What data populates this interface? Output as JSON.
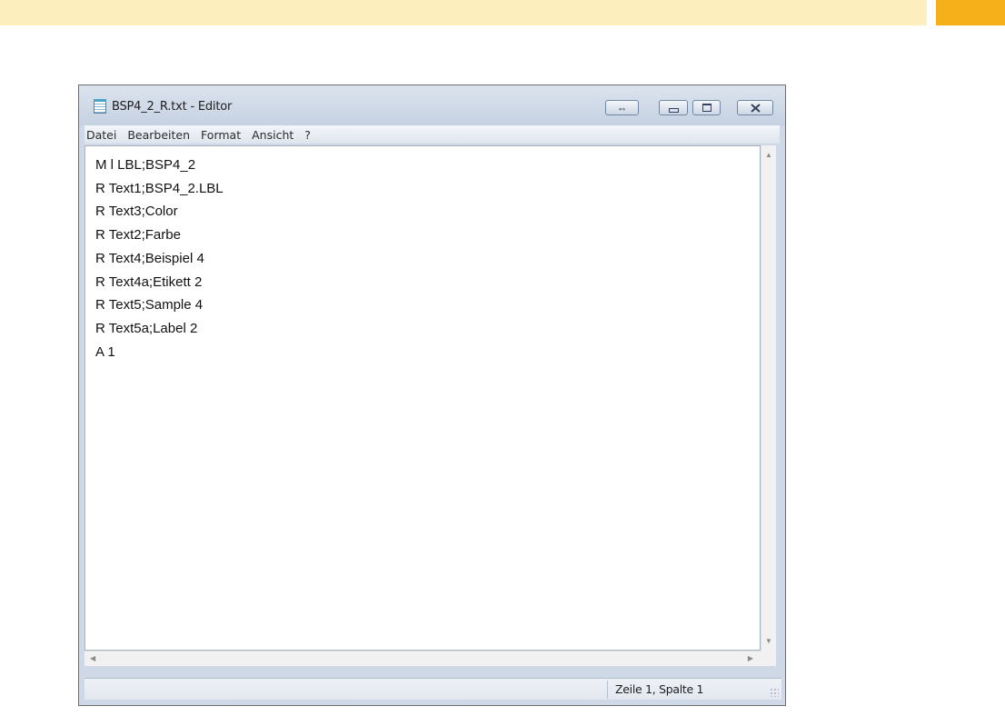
{
  "window": {
    "title": "BSP4_2_R.txt - Editor"
  },
  "titlebar_buttons": {
    "switch_symbol": "⇔"
  },
  "menu": {
    "items": [
      {
        "label": "Datei"
      },
      {
        "label": "Bearbeiten"
      },
      {
        "label": "Format"
      },
      {
        "label": "Ansicht"
      },
      {
        "label": "?"
      }
    ]
  },
  "editor": {
    "lines": [
      "M l LBL;BSP4_2",
      "R Text1;BSP4_2.LBL",
      "R Text3;Color",
      "R Text2;Farbe",
      "R Text4;Beispiel 4",
      "R Text4a;Etikett 2",
      "R Text5;Sample 4",
      "R Text5a;Label 2",
      "A 1"
    ]
  },
  "statusbar": {
    "position": "Zeile 1, Spalte 1"
  },
  "colors": {
    "top_band": "#fcefbd",
    "top_accent": "#f6b019"
  }
}
